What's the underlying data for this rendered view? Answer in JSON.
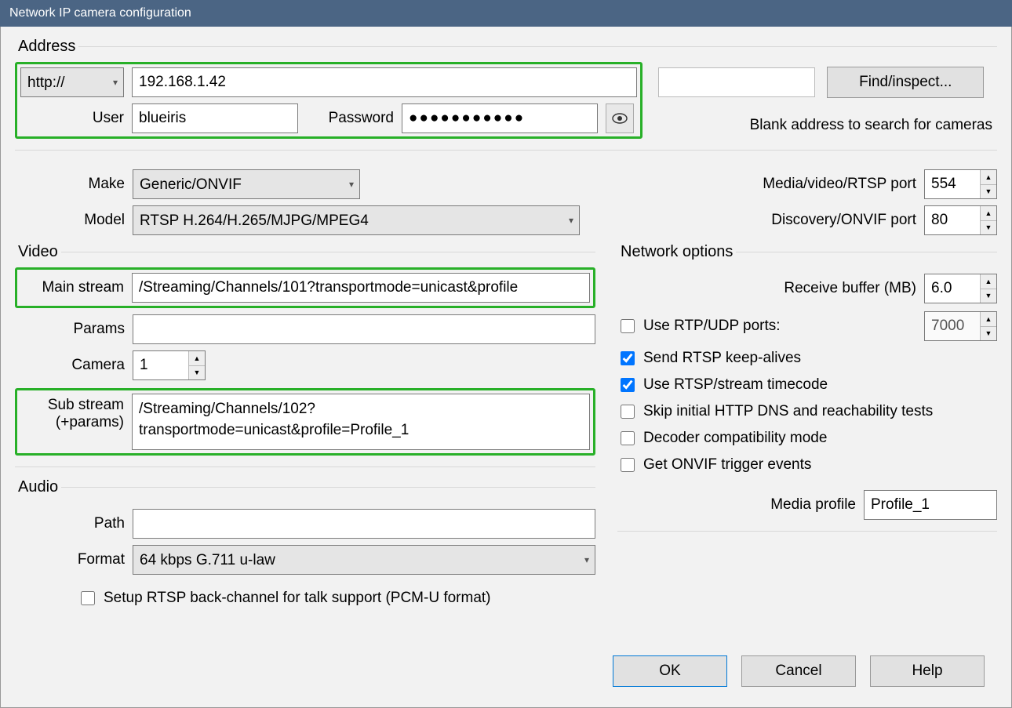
{
  "window": {
    "title": "Network IP camera configuration"
  },
  "address": {
    "legend": "Address",
    "protocol": "http://",
    "ip": "192.168.1.42",
    "user_label": "User",
    "user": "blueiris",
    "password_label": "Password",
    "password_mask": "●●●●●●●●●●●",
    "find_button": "Find/inspect...",
    "hint": "Blank address to search for cameras"
  },
  "device": {
    "make_label": "Make",
    "make": "Generic/ONVIF",
    "model_label": "Model",
    "model": "RTSP H.264/H.265/MJPG/MPEG4"
  },
  "ports": {
    "rtsp_label": "Media/video/RTSP port",
    "rtsp": "554",
    "onvif_label": "Discovery/ONVIF port",
    "onvif": "80"
  },
  "video": {
    "legend": "Video",
    "main_label": "Main stream",
    "main": "/Streaming/Channels/101?transportmode=unicast&profile",
    "params_label": "Params",
    "params": "",
    "camera_label": "Camera",
    "camera": "1",
    "sub_label_1": "Sub stream",
    "sub_label_2": "(+params)",
    "sub": "/Streaming/Channels/102?transportmode=unicast&profile=Profile_1"
  },
  "audio": {
    "legend": "Audio",
    "path_label": "Path",
    "path": "",
    "format_label": "Format",
    "format": "64 kbps G.711 u-law",
    "backchannel_label": "Setup RTSP back-channel for talk support (PCM-U format)"
  },
  "network": {
    "legend": "Network options",
    "buffer_label": "Receive buffer (MB)",
    "buffer": "6.0",
    "rtp_label": "Use RTP/UDP ports:",
    "rtp_port": "7000",
    "keepalive_label": "Send RTSP keep-alives",
    "timecode_label": "Use RTSP/stream timecode",
    "dns_label": "Skip initial HTTP DNS and reachability tests",
    "decoder_label": "Decoder compatibility mode",
    "onvif_events_label": "Get ONVIF trigger events",
    "media_profile_label": "Media profile",
    "media_profile": "Profile_1"
  },
  "buttons": {
    "ok": "OK",
    "cancel": "Cancel",
    "help": "Help"
  }
}
